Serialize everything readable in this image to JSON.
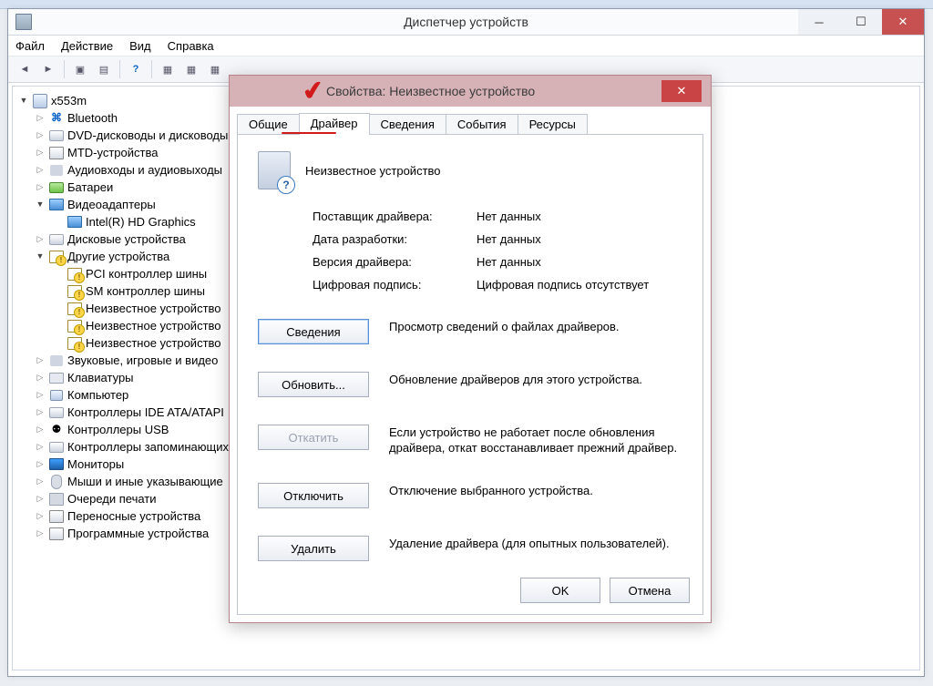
{
  "window": {
    "title": "Диспетчер устройств"
  },
  "menu": {
    "file": "Файл",
    "action": "Действие",
    "view": "Вид",
    "help": "Справка"
  },
  "tree": {
    "root": "x553m",
    "bluetooth": "Bluetooth",
    "dvd": "DVD-дисководы и дисководы",
    "mtd": "MTD-устройства",
    "audio": "Аудиовходы и аудиовыходы",
    "batteries": "Батареи",
    "video": "Видеоадаптеры",
    "video_child": "Intel(R) HD Graphics",
    "disk": "Дисковые устройства",
    "other": "Другие устройства",
    "other_1": "PCI контроллер шины",
    "other_2": "SM контроллер шины",
    "other_3": "Неизвестное устройство",
    "other_4": "Неизвестное устройство",
    "other_5": "Неизвестное устройство",
    "sound": "Звуковые, игровые и видео",
    "keyboards": "Клавиатуры",
    "computer": "Компьютер",
    "ide": "Контроллеры IDE ATA/ATAPI",
    "usb": "Контроллеры USB",
    "storage_ctrl": "Контроллеры запоминающих",
    "monitors": "Мониторы",
    "mice": "Мыши и иные указывающие",
    "print_queues": "Очереди печати",
    "portable": "Переносные устройства",
    "software_dev": "Программные устройства"
  },
  "dialog": {
    "title": "Свойства: Неизвестное устройство",
    "tabs": {
      "general": "Общие",
      "driver": "Драйвер",
      "details": "Сведения",
      "events": "События",
      "resources": "Ресурсы"
    },
    "device_name": "Неизвестное устройство",
    "labels": {
      "provider": "Поставщик драйвера:",
      "date": "Дата разработки:",
      "version": "Версия драйвера:",
      "signature": "Цифровая подпись:"
    },
    "values": {
      "provider": "Нет данных",
      "date": "Нет данных",
      "version": "Нет данных",
      "signature": "Цифровая подпись отсутствует"
    },
    "buttons": {
      "details": "Сведения",
      "details_desc": "Просмотр сведений о файлах драйверов.",
      "update": "Обновить...",
      "update_desc": "Обновление драйверов для этого устройства.",
      "rollback": "Откатить",
      "rollback_desc": "Если устройство не работает после обновления драйвера, откат восстанавливает прежний драйвер.",
      "disable": "Отключить",
      "disable_desc": "Отключение выбранного устройства.",
      "uninstall": "Удалить",
      "uninstall_desc": "Удаление драйвера (для опытных пользователей)."
    },
    "ok": "OK",
    "cancel": "Отмена"
  }
}
